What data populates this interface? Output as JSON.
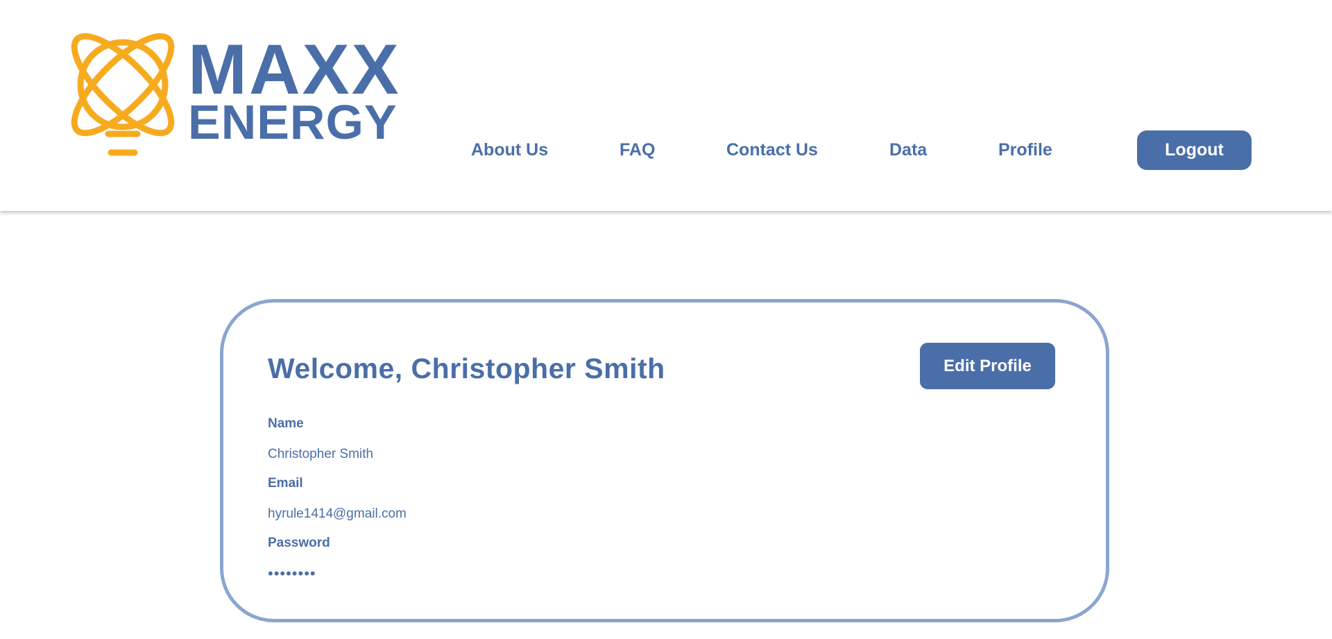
{
  "brand": {
    "line1": "MAXX",
    "line2": "ENERGY",
    "logo_icon": "atom-lightbulb-icon",
    "primary_color": "#4a6ea8",
    "logo_color": "#f6ab1f"
  },
  "nav": {
    "items": [
      {
        "label": "About Us"
      },
      {
        "label": "FAQ"
      },
      {
        "label": "Contact Us"
      },
      {
        "label": "Data"
      },
      {
        "label": "Profile"
      }
    ],
    "logout_label": "Logout"
  },
  "profile": {
    "welcome": "Welcome, Christopher Smith",
    "edit_label": "Edit Profile",
    "fields": [
      {
        "label": "Name",
        "value": "Christopher Smith"
      },
      {
        "label": "Email",
        "value": "hyrule1414@gmail.com"
      },
      {
        "label": "Password",
        "value": "••••••••"
      }
    ],
    "card_border_color": "#8aa6cf"
  }
}
